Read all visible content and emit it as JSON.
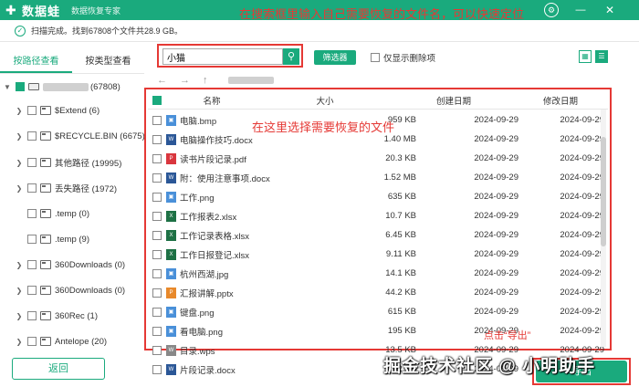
{
  "titlebar": {
    "app_name": "数据蛙",
    "subtitle": "数据恢复专家",
    "controls": [
      "settings",
      "minimize",
      "close"
    ]
  },
  "status": {
    "text": "扫描完成。找到67808个文件共28.9 GB。",
    "annotation": "在搜索框里输入自己需要恢复的文件名，可以快速定位"
  },
  "left_panel": {
    "tabs": [
      {
        "label": "按路径查看",
        "active": true
      },
      {
        "label": "按类型查看",
        "active": false
      }
    ],
    "root": {
      "label": "(67808)",
      "checked": true
    },
    "items": [
      {
        "label": "$Extend (6)"
      },
      {
        "label": "$RECYCLE.BIN (6675)"
      },
      {
        "label": "其他路径 (19995)"
      },
      {
        "label": "丢失路径 (1972)"
      },
      {
        "label": ".temp (0)"
      },
      {
        "label": ".temp (9)"
      },
      {
        "label": "360Downloads (0)"
      },
      {
        "label": "360Downloads (0)"
      },
      {
        "label": "360Rec (1)"
      },
      {
        "label": "Antelope (20)"
      }
    ],
    "back_label": "返回"
  },
  "toolbar": {
    "search_value": "小猫",
    "filter_label": "筛选器",
    "only_deleted_label": "仅显示删除项"
  },
  "table": {
    "headers": {
      "name": "名称",
      "size": "大小",
      "created": "创建日期",
      "modified": "修改日期"
    },
    "annotation": "在这里选择需要恢复的文件",
    "rows": [
      {
        "name": "电脑.bmp",
        "size": "959 KB",
        "created": "2024-09-29",
        "modified": "2024-09-29",
        "icon": "image",
        "color": "#4a90d9"
      },
      {
        "name": "电脑操作技巧.docx",
        "size": "1.40 MB",
        "created": "2024-09-29",
        "modified": "2024-09-29",
        "icon": "word",
        "color": "#2b5797"
      },
      {
        "name": "读书片段记录.pdf",
        "size": "20.3 KB",
        "created": "2024-09-29",
        "modified": "2024-09-29",
        "icon": "pdf",
        "color": "#d9363e"
      },
      {
        "name": "附：使用注意事项.docx",
        "size": "1.52 MB",
        "created": "2024-09-29",
        "modified": "2024-09-29",
        "icon": "word",
        "color": "#2b5797"
      },
      {
        "name": "工作.png",
        "size": "635 KB",
        "created": "2024-09-29",
        "modified": "2024-09-29",
        "icon": "image",
        "color": "#4a90d9"
      },
      {
        "name": "工作报表2.xlsx",
        "size": "10.7 KB",
        "created": "2024-09-29",
        "modified": "2024-09-29",
        "icon": "excel",
        "color": "#1e7145"
      },
      {
        "name": "工作记录表格.xlsx",
        "size": "6.45 KB",
        "created": "2024-09-29",
        "modified": "2024-09-29",
        "icon": "excel",
        "color": "#1e7145"
      },
      {
        "name": "工作日报登记.xlsx",
        "size": "9.11 KB",
        "created": "2024-09-29",
        "modified": "2024-09-29",
        "icon": "excel",
        "color": "#1e7145"
      },
      {
        "name": "杭州西湖.jpg",
        "size": "14.1 KB",
        "created": "2024-09-29",
        "modified": "2024-09-29",
        "icon": "image",
        "color": "#4a90d9"
      },
      {
        "name": "汇报讲解.pptx",
        "size": "44.2 KB",
        "created": "2024-09-29",
        "modified": "2024-09-29",
        "icon": "ppt",
        "color": "#e8892b"
      },
      {
        "name": "键盘.png",
        "size": "615 KB",
        "created": "2024-09-29",
        "modified": "2024-09-29",
        "icon": "image",
        "color": "#4a90d9"
      },
      {
        "name": "看电脑.png",
        "size": "195 KB",
        "created": "2024-09-29",
        "modified": "2024-09-29",
        "icon": "image",
        "color": "#4a90d9"
      },
      {
        "name": "目录.wps",
        "size": "13.5 KB",
        "created": "2024-09-29",
        "modified": "2024-09-29",
        "icon": "wps",
        "color": "#888888"
      },
      {
        "name": "片段记录.docx",
        "size": "13.2 KB",
        "created": "2024-09-29",
        "modified": "2024-09-29",
        "icon": "word",
        "color": "#2b5797"
      }
    ]
  },
  "export": {
    "label": "导出",
    "annotation": "点击“导出”"
  },
  "watermark": "掘金技术社区 @ 小明助手",
  "colors": {
    "accent": "#1aaa7d",
    "annotation": "#e53935"
  }
}
